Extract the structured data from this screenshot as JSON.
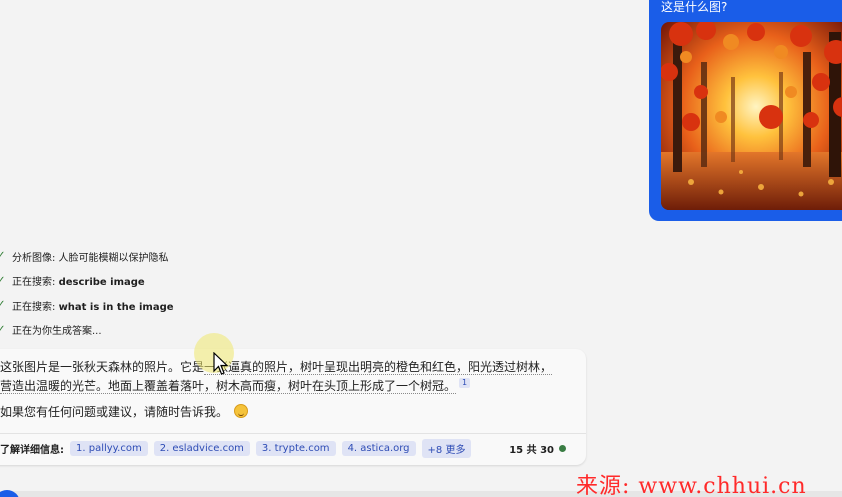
{
  "user_message": {
    "question": "这是什么图?"
  },
  "progress_steps": [
    {
      "prefix": "分析图像: 人脸可能模糊以保护隐私",
      "bold": ""
    },
    {
      "prefix": "正在搜索: ",
      "bold": "describe image"
    },
    {
      "prefix": "正在搜索: ",
      "bold": "what is in the image"
    },
    {
      "prefix": "正在为你生成答案...",
      "bold": ""
    }
  ],
  "answer": {
    "line1_a": "这张图片是一张秋天森林的照片。它是",
    "line1_b": "一张逼真的照片，树叶呈现出明亮的橙色和红色，阳光透过树林，",
    "line2": "营造出温暖的光芒。地面上覆盖着落叶，树木高而瘦，树叶在头顶上形成了一个树冠。",
    "citation": "1",
    "followup": "如果您有任何问题或建议，请随时告诉我。"
  },
  "learn_more": {
    "label": "了解详细信息:",
    "sources": [
      "1. pallyy.com",
      "2. esladvice.com",
      "3. trypte.com",
      "4. astica.org"
    ],
    "more": "+8 更多",
    "count": "15 共 30"
  },
  "watermark": "来源: www.chhui.cn",
  "colors": {
    "user_bubble": "#1a5de8",
    "chip_bg": "#dfe3f5",
    "chip_text": "#2e4cb5",
    "check": "#2e7d32",
    "watermark": "#ff2a2a"
  }
}
